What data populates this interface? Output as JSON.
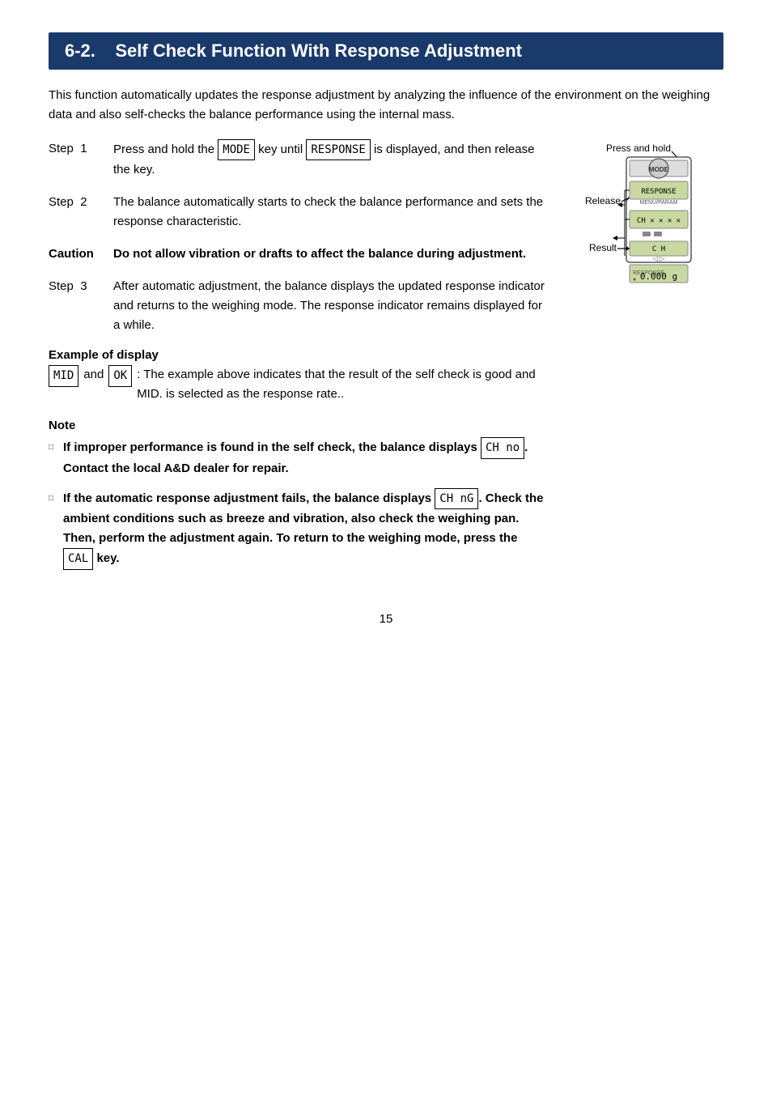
{
  "page": {
    "number": "15"
  },
  "header": {
    "section": "6-2.",
    "title": "Self Check Function With Response Adjustment"
  },
  "intro": "This function automatically updates the response adjustment by analyzing the influence of the environment on the weighing data and also self-checks the balance performance using the internal mass.",
  "steps": [
    {
      "label": "Step  1",
      "text_parts": [
        "Press and hold the ",
        "MODE",
        " key until ",
        "RESPONSE",
        " is displayed, and then release the key."
      ]
    },
    {
      "label": "Step  2",
      "text": "The balance automatically starts to check the balance performance and sets the response characteristic."
    },
    {
      "label": "Caution",
      "text": "Do not allow vibration or drafts to affect the balance during adjustment.",
      "bold": true
    },
    {
      "label": "Step  3",
      "text": "After automatic adjustment, the balance displays the updated response indicator and returns to the weighing mode. The response indicator remains displayed for a while."
    }
  ],
  "example": {
    "title": "Example of display",
    "mid_box": "MID",
    "ok_box": "OK",
    "description": ":  The example above indicates that the result of the self check is good and MID. is selected as the response rate.."
  },
  "note": {
    "label": "Note",
    "items": [
      {
        "bold_part": "If improper performance is found in the self check, the balance displays",
        "display_box": "CH no",
        "rest": ". Contact the local A&D dealer for repair."
      },
      {
        "bold_part": "If the automatic response adjustment fails, the balance displays",
        "display_box": "CH nG",
        "rest": ". Check the ambient conditions such as breeze and vibration, also check the weighing pan. Then, perform the adjustment again. To return to the weighing mode, press the",
        "cal_box": "CAL",
        "end": " key."
      }
    ]
  },
  "diagram": {
    "press_hold_label": "Press and hold",
    "release_label": "Release",
    "result_label": "Result",
    "mode_key": "MODE",
    "lcd1": "CH ✕ ✕ ✕ ✕",
    "lcd2": "CH",
    "lcd3": "0.000 g"
  }
}
